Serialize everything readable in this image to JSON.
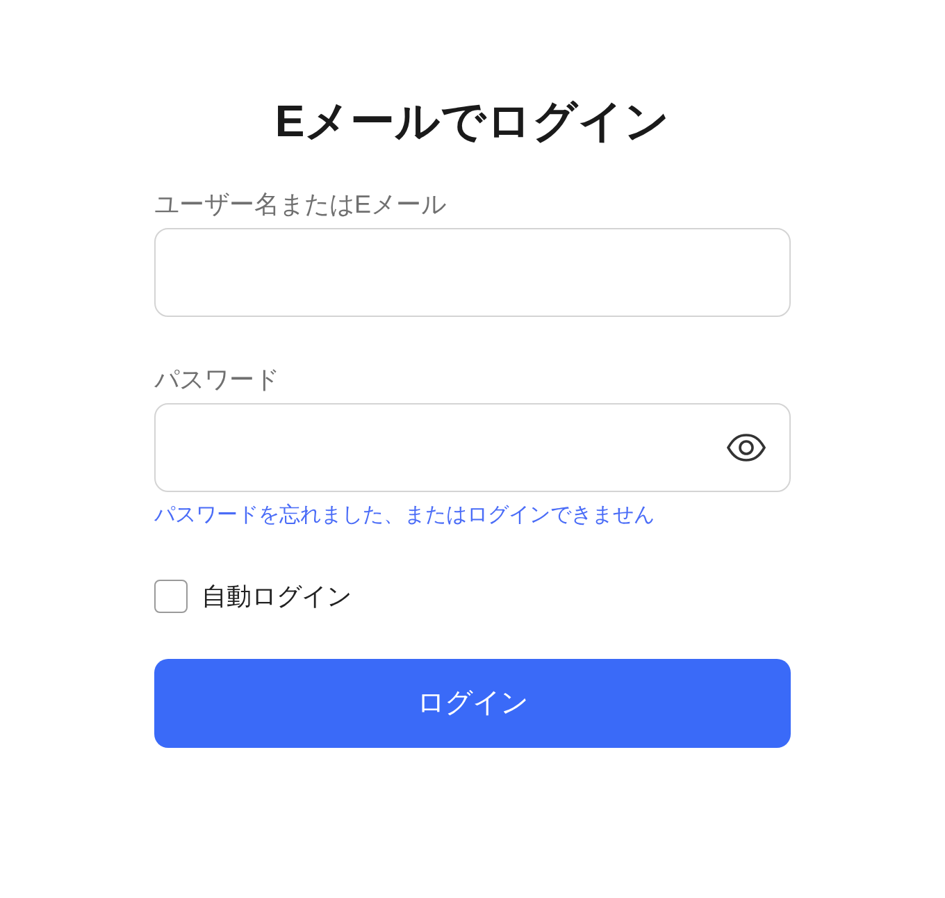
{
  "title": "Eメールでログイン",
  "username": {
    "label": "ユーザー名またはEメール"
  },
  "password": {
    "label": "パスワード"
  },
  "forgot_link": "パスワードを忘れました、またはログインできません",
  "auto_login": {
    "label": "自動ログイン",
    "checked": false
  },
  "login_button": "ログイン"
}
